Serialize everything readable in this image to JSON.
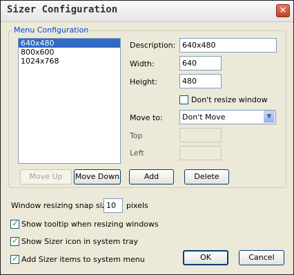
{
  "window": {
    "title": "Sizer Configuration",
    "close_label": "✕"
  },
  "menu_config": {
    "group_label": "Menu Configuration",
    "list_items": [
      "640x480",
      "800x600",
      "1024x768"
    ],
    "selected_index": 0,
    "description_label": "Description:",
    "description_value": "640x480",
    "width_label": "Width:",
    "width_value": "640",
    "height_label": "Height:",
    "height_value": "480",
    "dont_resize_label": "Don't resize window",
    "dont_resize_checked": false,
    "move_to_label": "Move to:",
    "move_to_value": "Don't Move",
    "top_label": "Top",
    "top_value": "",
    "left_label": "Left",
    "left_value": "",
    "move_up_label": "Move Up",
    "move_down_label": "Move Down",
    "add_label": "Add",
    "delete_label": "Delete"
  },
  "options": {
    "snap_label": "Window resizing snap size:",
    "snap_value": "10",
    "snap_unit": "pixels",
    "tooltip_label": "Show tooltip when resizing windows",
    "tooltip_checked": true,
    "tray_label": "Show Sizer icon in system tray",
    "tray_checked": true,
    "sysmenu_label": "Add Sizer items to system menu",
    "sysmenu_checked": true
  },
  "footer": {
    "ok_label": "OK",
    "cancel_label": "Cancel"
  }
}
